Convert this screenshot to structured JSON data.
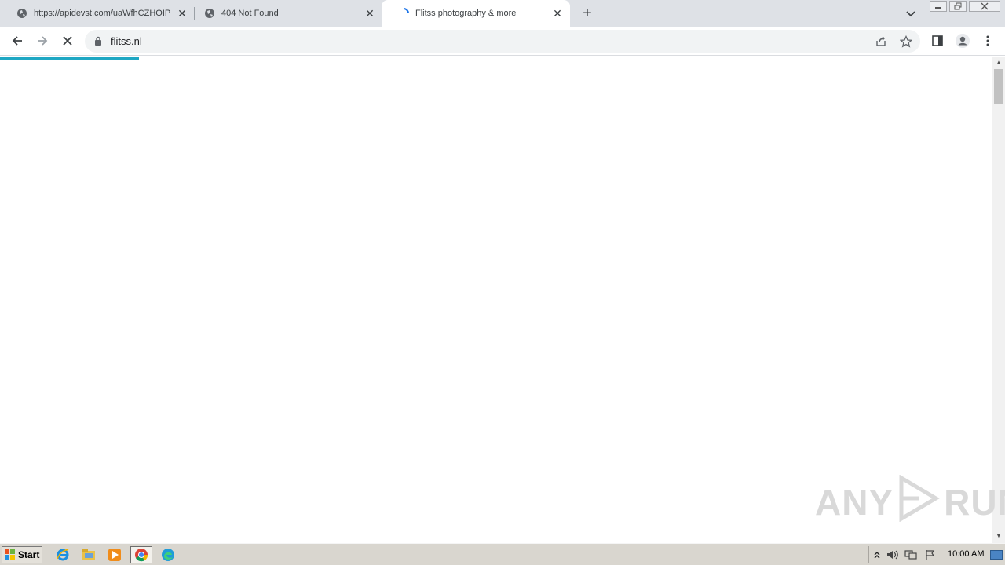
{
  "browser": {
    "tabs": [
      {
        "title": "https://apidevst.com/uaWfhCZHOIP",
        "active": false
      },
      {
        "title": "404 Not Found",
        "active": false
      },
      {
        "title": "Flitss photography & more",
        "active": true
      }
    ],
    "new_tab_symbol": "+",
    "close_symbol": "✕",
    "address": "flitss.nl",
    "loading_progress_percent": 14,
    "accent_color": "#1ea7c3"
  },
  "watermark": {
    "left": "ANY",
    "right": "RUN"
  },
  "taskbar": {
    "start_label": "Start",
    "pinned": [
      "ie-icon",
      "explorer-icon",
      "media-player-icon",
      "chrome-icon",
      "edge-icon"
    ],
    "clock": "10:00 AM"
  }
}
